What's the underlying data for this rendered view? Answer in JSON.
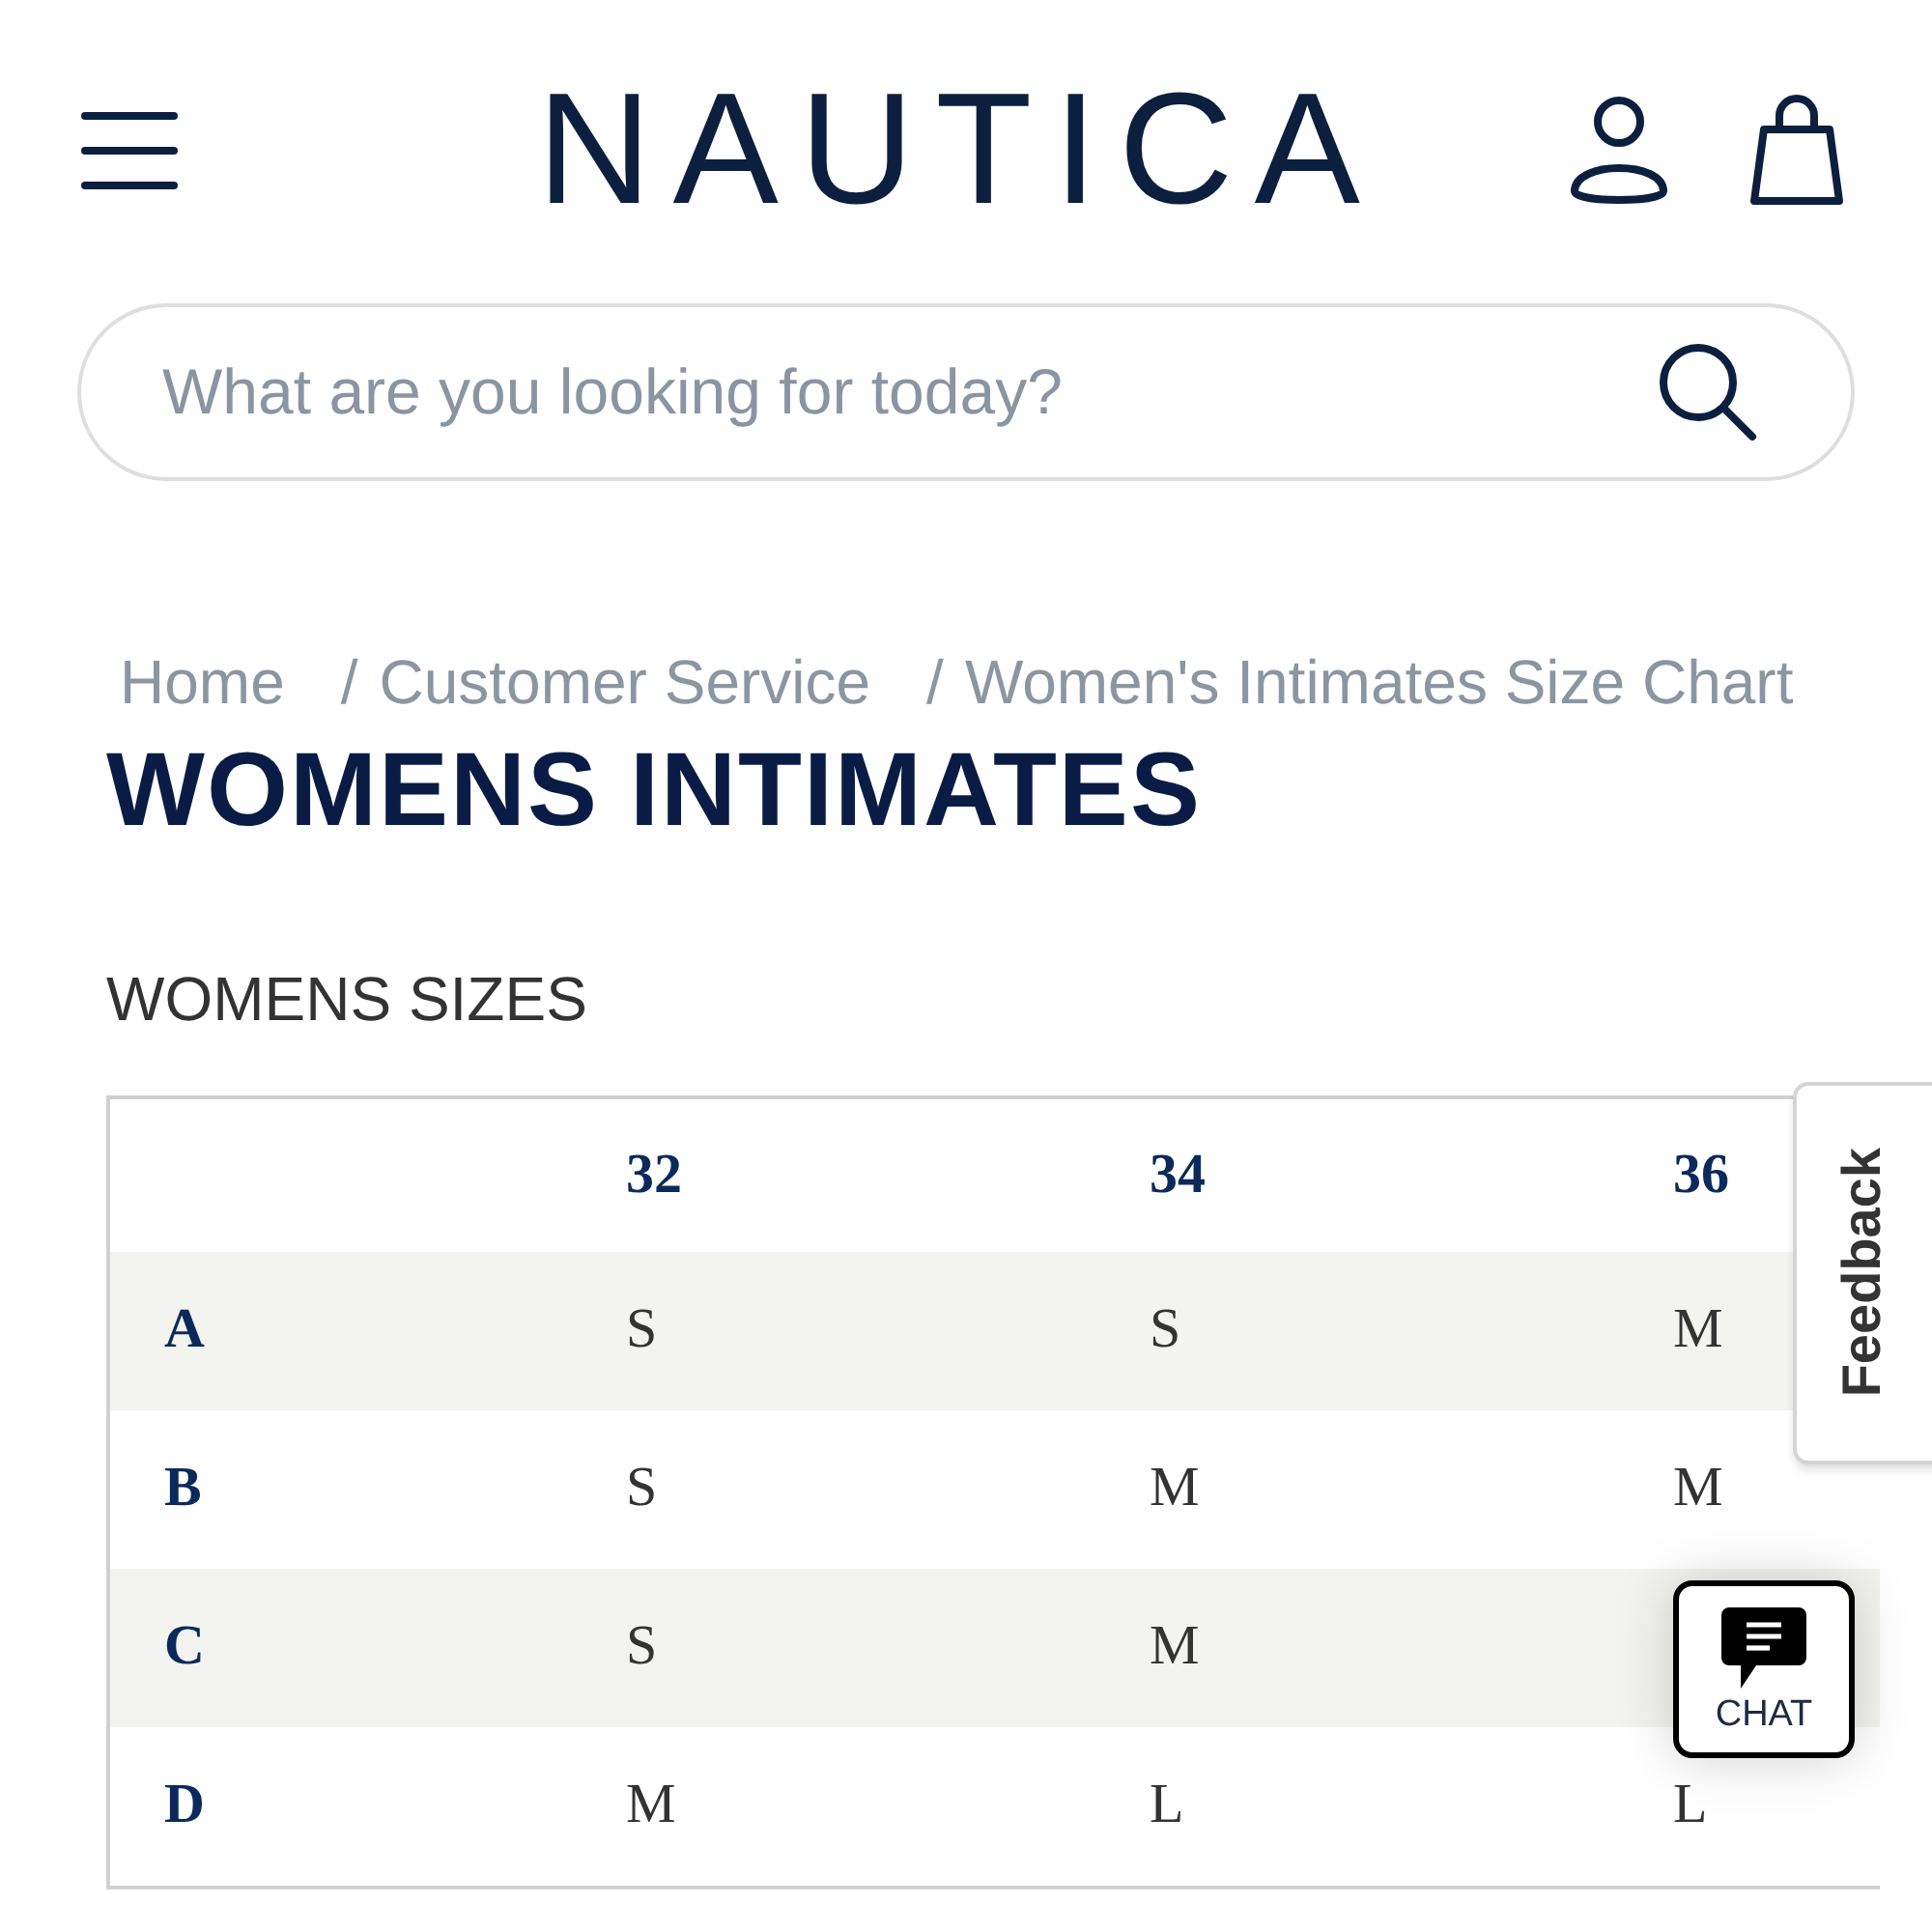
{
  "header": {
    "logo": "NAUTICA"
  },
  "search": {
    "placeholder": "What are you looking for today?"
  },
  "breadcrumb": [
    {
      "text": "Home"
    },
    {
      "separator": "/",
      "text": "Customer Service"
    },
    {
      "separator": "/",
      "text": "Women's Intimates Size Chart"
    }
  ],
  "page_title": "WOMENS INTIMATES",
  "section_title": "WOMENS SIZES",
  "size_table": {
    "columns": [
      "32",
      "34",
      "36"
    ],
    "rows": [
      {
        "label": "A",
        "cells": [
          "S",
          "S",
          "M"
        ]
      },
      {
        "label": "B",
        "cells": [
          "S",
          "M",
          "M"
        ]
      },
      {
        "label": "C",
        "cells": [
          "S",
          "M"
        ]
      },
      {
        "label": "D",
        "cells": [
          "M",
          "L",
          "L"
        ]
      }
    ]
  },
  "feedback_tab": {
    "label": "Feedback"
  },
  "chat_button": {
    "label": "CHAT"
  }
}
